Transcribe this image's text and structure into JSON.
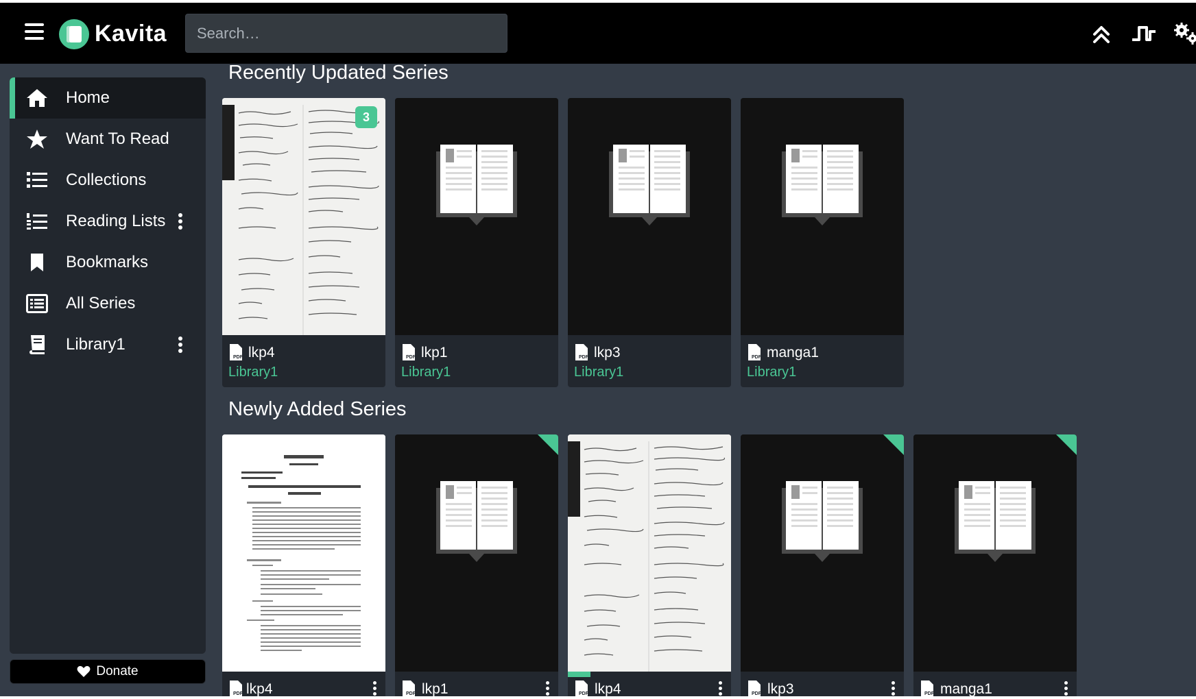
{
  "app": {
    "name": "Kavita"
  },
  "search": {
    "placeholder": "Search…"
  },
  "header_icons": [
    "scroll-to-top-icon",
    "activity-pulse-icon",
    "settings-gears-icon"
  ],
  "sidebar": {
    "items": [
      {
        "label": "Home",
        "icon": "home-icon",
        "active": true
      },
      {
        "label": "Want To Read",
        "icon": "star-icon"
      },
      {
        "label": "Collections",
        "icon": "list-icon"
      },
      {
        "label": "Reading Lists",
        "icon": "ordered-list-icon",
        "has_menu": true
      },
      {
        "label": "Bookmarks",
        "icon": "bookmark-icon"
      },
      {
        "label": "All Series",
        "icon": "series-list-icon"
      },
      {
        "label": "Library1",
        "icon": "book-icon",
        "has_menu": true
      }
    ],
    "donate_label": "Donate"
  },
  "sections": [
    {
      "title": "Recently Updated Series",
      "cards": [
        {
          "title": "lkp4",
          "library": "Library1",
          "cover": "handwritten-notes",
          "badge": "3"
        },
        {
          "title": "lkp1",
          "library": "Library1",
          "cover": "placeholder-book"
        },
        {
          "title": "lkp3",
          "library": "Library1",
          "cover": "placeholder-book"
        },
        {
          "title": "manga1",
          "library": "Library1",
          "cover": "placeholder-book"
        }
      ]
    },
    {
      "title": "Newly Added Series",
      "cards": [
        {
          "title": "lkp4",
          "cover": "typed-document"
        },
        {
          "title": "lkp1",
          "cover": "placeholder-book",
          "unread_corner": true
        },
        {
          "title": "lkp4",
          "cover": "handwritten-notes",
          "progress": 0.14
        },
        {
          "title": "lkp3",
          "cover": "placeholder-book",
          "unread_corner": true
        },
        {
          "title": "manga1",
          "cover": "placeholder-book",
          "unread_corner": true
        }
      ]
    }
  ],
  "colors": {
    "accent": "#4ac694",
    "header": "#000000",
    "background": "#343c47",
    "sidebar": "#22272e"
  }
}
